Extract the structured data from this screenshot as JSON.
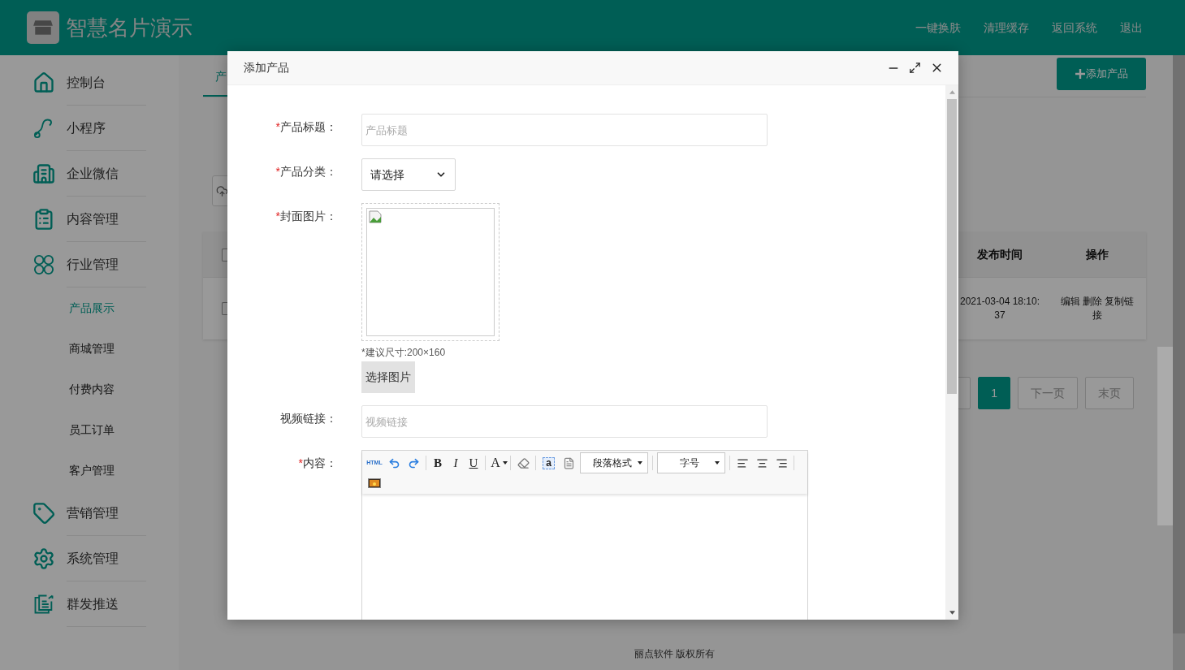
{
  "header": {
    "title": "智慧名片演示",
    "links": [
      "一键换肤",
      "清理缓存",
      "返回系统",
      "退出"
    ]
  },
  "sidebar": {
    "items": [
      {
        "label": "控制台",
        "selected": false
      },
      {
        "label": "小程序",
        "selected": false
      },
      {
        "label": "企业微信",
        "selected": false
      },
      {
        "label": "内容管理",
        "selected": false
      },
      {
        "label": "行业管理",
        "selected": false,
        "expanded": true,
        "children": [
          {
            "label": "产品展示",
            "selected": true
          },
          {
            "label": "商城管理",
            "selected": false
          },
          {
            "label": "付费内容",
            "selected": false
          },
          {
            "label": "员工订单",
            "selected": false
          },
          {
            "label": "客户管理",
            "selected": false
          }
        ]
      },
      {
        "label": "营销管理",
        "selected": false
      },
      {
        "label": "系统管理",
        "selected": false
      },
      {
        "label": "群发推送",
        "selected": false
      }
    ]
  },
  "main": {
    "tab": {
      "label": "产",
      "selected": true
    },
    "add_button": "添加产品",
    "table": {
      "columns": [
        "发布时间",
        "操作"
      ],
      "header_checked": false,
      "rows": [
        {
          "checked": false,
          "time": "2021-03-04 18:10:37",
          "actions": "编辑 删除 复制链接"
        }
      ]
    },
    "pagination": [
      {
        "selected": false
      },
      {
        "label": "1",
        "selected": true
      },
      {
        "label": "下一页",
        "selected": false
      },
      {
        "label": "末页",
        "selected": false
      }
    ],
    "footer": "丽点软件 版权所有"
  },
  "dialog": {
    "title": "添加产品",
    "fields": [
      {
        "kind": "text",
        "required_mark": "*",
        "label": "产品标题：",
        "placeholder": "产品标题"
      },
      {
        "kind": "select",
        "required_mark": "*",
        "label": "产品分类：",
        "value": "请选择"
      },
      {
        "kind": "image",
        "required_mark": "*",
        "label": "封面图片：",
        "hint": "*建议尺寸:200×160",
        "button": "选择图片"
      },
      {
        "kind": "text",
        "label": "视频链接：",
        "placeholder": "视频链接"
      },
      {
        "kind": "editor",
        "required_mark": "*",
        "label": "内容：",
        "toolbar": [
          {
            "kind": "html",
            "label": "HTML"
          },
          {
            "kind": "undo"
          },
          {
            "kind": "redo"
          },
          {
            "kind": "sep"
          },
          {
            "kind": "letter",
            "label": "B"
          },
          {
            "kind": "letter",
            "label": "I"
          },
          {
            "kind": "letter",
            "label": "U"
          },
          {
            "kind": "sep"
          },
          {
            "kind": "color",
            "label": "A"
          },
          {
            "kind": "sep"
          },
          {
            "kind": "eraser"
          },
          {
            "kind": "sep"
          },
          {
            "kind": "boxed",
            "label": "a"
          },
          {
            "kind": "page"
          },
          {
            "kind": "dropdown",
            "label": "段落格式"
          },
          {
            "kind": "sep"
          },
          {
            "kind": "dropdown",
            "label": "字号"
          },
          {
            "kind": "sep"
          },
          {
            "kind": "align-left"
          },
          {
            "kind": "align-center"
          },
          {
            "kind": "align-right"
          },
          {
            "kind": "sep"
          },
          {
            "kind": "image"
          }
        ]
      }
    ]
  }
}
